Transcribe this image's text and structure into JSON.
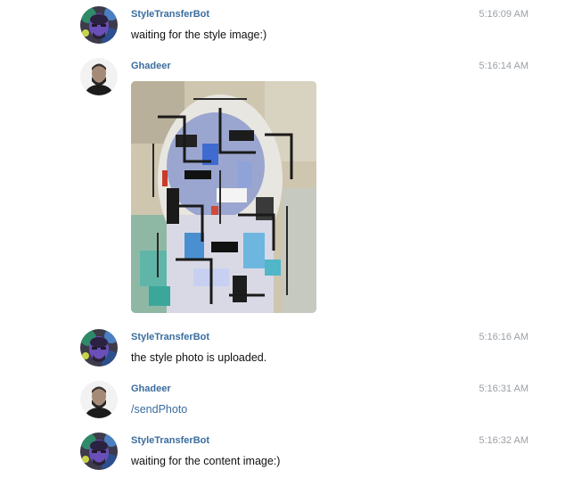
{
  "messages": [
    {
      "author": "StyleTransferBot",
      "avatar_icon": "bot-avatar-icon",
      "time": "5:16:09 AM",
      "text": "waiting for the style image:)"
    },
    {
      "author": "Ghadeer",
      "avatar_icon": "user-avatar-icon",
      "time": "5:16:14 AM",
      "image": "stylized-portrait-image"
    },
    {
      "author": "StyleTransferBot",
      "avatar_icon": "bot-avatar-icon",
      "time": "5:16:16 AM",
      "text": "the style photo is uploaded."
    },
    {
      "author": "Ghadeer",
      "avatar_icon": "user-avatar-icon",
      "time": "5:16:31 AM",
      "text": "/sendPhoto"
    },
    {
      "author": "StyleTransferBot",
      "avatar_icon": "bot-avatar-icon",
      "time": "5:16:32 AM",
      "text": "waiting for the content image:)"
    }
  ],
  "colors": {
    "author": "#3a6d9e",
    "timestamp": "#9aa0a6",
    "link": "#3a6d9e",
    "text": "#111111"
  }
}
